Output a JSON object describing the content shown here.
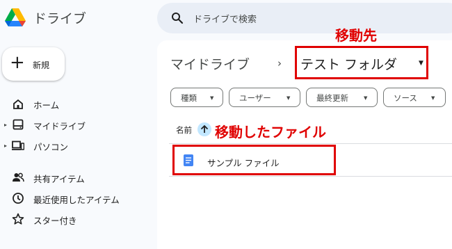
{
  "header": {
    "app_title": "ドライブ",
    "search_placeholder": "ドライブで検索"
  },
  "sidebar": {
    "new_label": "新規",
    "items": [
      {
        "label": "ホーム",
        "icon": "home-icon"
      },
      {
        "label": "マイドライブ",
        "icon": "drive-icon"
      },
      {
        "label": "パソコン",
        "icon": "computer-icon"
      },
      {
        "label": "共有アイテム",
        "icon": "shared-icon"
      },
      {
        "label": "最近使用したアイテム",
        "icon": "clock-icon"
      },
      {
        "label": "スター付き",
        "icon": "star-icon"
      }
    ]
  },
  "breadcrumb": {
    "root": "マイドライブ",
    "separator": "›",
    "current": "テスト フォルダ"
  },
  "filters": [
    {
      "label": "種類"
    },
    {
      "label": "ユーザー"
    },
    {
      "label": "最終更新"
    },
    {
      "label": "ソース"
    }
  ],
  "list": {
    "sort_label": "名前",
    "sort_direction": "ascending",
    "files": [
      {
        "name": "サンプル ファイル",
        "icon": "document-icon"
      }
    ]
  },
  "annotations": {
    "destination_label": "移動先",
    "moved_file_label": "移動したファイル",
    "color": "#e00000"
  },
  "colors": {
    "accent": "#c2e7ff",
    "doc_blue": "#4285f4"
  }
}
